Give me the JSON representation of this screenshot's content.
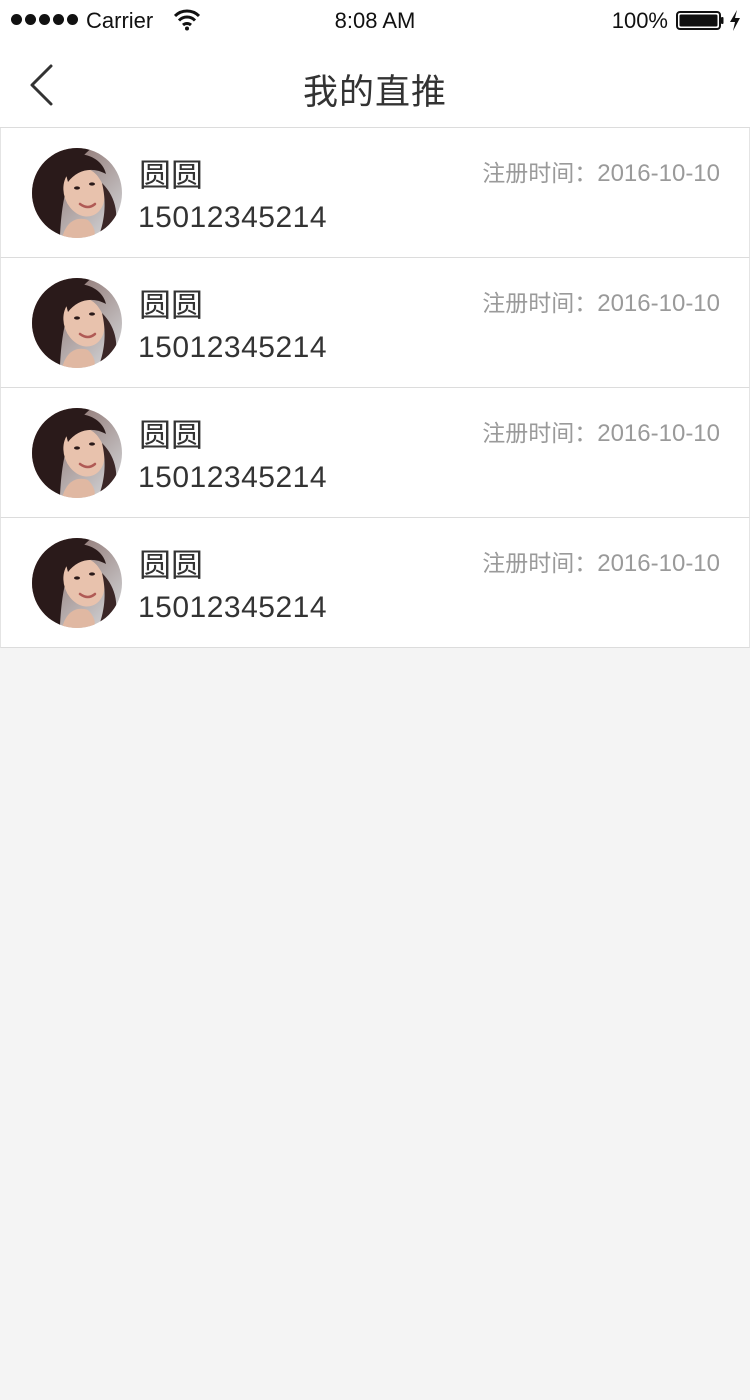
{
  "status_bar": {
    "carrier": "Carrier",
    "time": "8:08 AM",
    "battery": "100%",
    "signal_icon": "signal-dots-icon",
    "wifi_icon": "wifi-icon",
    "battery_icon": "battery-icon",
    "charging_icon": "charging-bolt-icon"
  },
  "nav": {
    "title": "我的直推",
    "back_icon": "chevron-left-icon"
  },
  "colors": {
    "background": "#f4f4f4",
    "card": "#ffffff",
    "text": "#333333",
    "muted": "#9a9a9a",
    "divider": "#dcdcdc"
  },
  "list": {
    "items": [
      {
        "name": "圆圆",
        "phone": "15012345214",
        "date_label": "注册时间：",
        "date": "2016-10-10"
      },
      {
        "name": "圆圆",
        "phone": "15012345214",
        "date_label": "注册时间：",
        "date": "2016-10-10"
      },
      {
        "name": "圆圆",
        "phone": "15012345214",
        "date_label": "注册时间：",
        "date": "2016-10-10"
      },
      {
        "name": "圆圆",
        "phone": "15012345214",
        "date_label": "注册时间：",
        "date": "2016-10-10"
      }
    ]
  }
}
